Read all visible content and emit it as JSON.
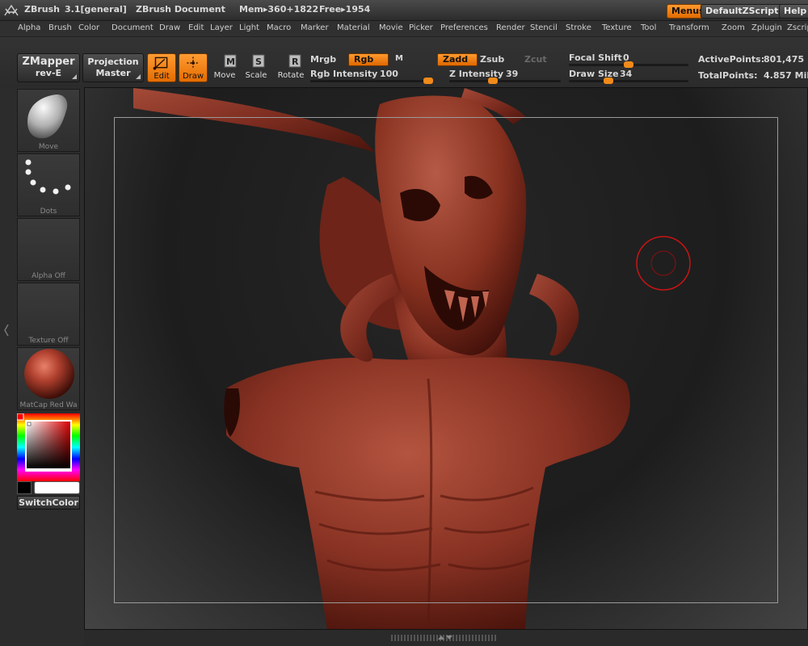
{
  "titlebar": {
    "app_name": "ZBrush",
    "version": "3.1[general]",
    "document": "ZBrush Document",
    "mem": "Mem▸360+1822",
    "free": "Free▸1954",
    "menus_label": "Menus",
    "script_label": "DefaultZScript",
    "help_label": "Help"
  },
  "menubar": [
    "Alpha",
    "Brush",
    "Color",
    "Document",
    "Draw",
    "Edit",
    "Layer",
    "Light",
    "Macro",
    "Marker",
    "Material",
    "Movie",
    "Picker",
    "Preferences",
    "Render",
    "Stencil",
    "Stroke",
    "Texture",
    "Tool",
    "Transform",
    "Zoom",
    "Zplugin",
    "Zscript"
  ],
  "toolbar": {
    "zmapper": {
      "line1": "ZMapper",
      "line2": "rev-E"
    },
    "projection": {
      "line1": "Projection",
      "line2": "Master"
    },
    "tools": [
      {
        "label": "Edit",
        "icon": "edit-icon",
        "active": true
      },
      {
        "label": "Draw",
        "icon": "draw-icon",
        "active": true
      },
      {
        "label": "Move",
        "icon": "move-icon",
        "active": false
      },
      {
        "label": "Scale",
        "icon": "scale-icon",
        "active": false
      },
      {
        "label": "Rotate",
        "icon": "rotate-icon",
        "active": false
      }
    ],
    "mrgb": "Mrgb",
    "rgb": "Rgb",
    "m": "M",
    "rgb_intensity_label": "Rgb Intensity",
    "rgb_intensity": "100",
    "rgb_intensity_level": 1.0,
    "zadd": "Zadd",
    "zsub": "Zsub",
    "zcut": "Zcut",
    "z_intensity_label": "Z Intensity",
    "z_intensity": "39",
    "z_intensity_level": 0.39,
    "focal_shift_label": "Focal Shift",
    "focal_shift": "0",
    "focal_shift_level": 0.5,
    "draw_size_label": "Draw Size",
    "draw_size": "34",
    "draw_size_level": 0.33,
    "active_points_label": "ActivePoints:",
    "active_points": "801,475",
    "total_points_label": "TotalPoints:",
    "total_points": "4.857 Mil"
  },
  "tray": {
    "brush_caption": "Move",
    "stroke_caption": "Dots",
    "alpha_caption": "Alpha  Off",
    "texture_caption": "Texture  Off",
    "material_caption": "MatCap  Red  Wa",
    "switch_color": "SwitchColor",
    "main_color": "#000000",
    "secondary_color": "#ffffff"
  },
  "colors": {
    "accent": "#f08a1a",
    "clay": "#8a3326"
  }
}
